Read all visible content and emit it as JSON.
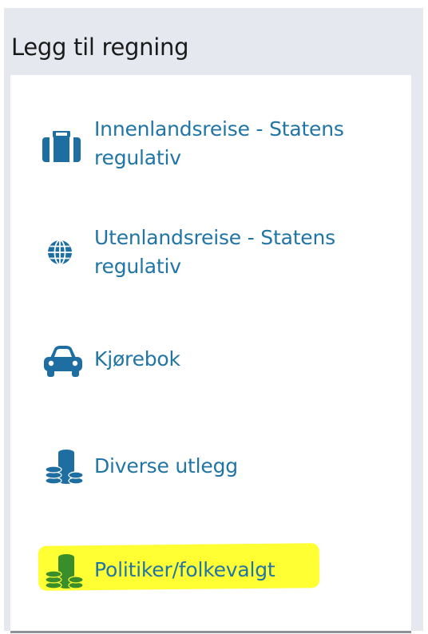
{
  "panel": {
    "title": "Legg til regning"
  },
  "menu": {
    "items": [
      {
        "label": "Innenlandsreise - Statens regulativ",
        "icon": "suitcase-icon"
      },
      {
        "label": "Utenlandsreise - Statens regulativ",
        "icon": "globe-icon"
      },
      {
        "label": "Kjørebok",
        "icon": "car-icon"
      },
      {
        "label": "Diverse utlegg",
        "icon": "coins-icon"
      },
      {
        "label": "Politiker/folkevalgt",
        "icon": "coins-icon"
      }
    ]
  },
  "colors": {
    "link": "#2175a5",
    "icon": "#1f6ea1",
    "highlighted_icon": "#3a8d2b",
    "highlight": "#ffff33",
    "panel_background": "#e5e9ef"
  }
}
